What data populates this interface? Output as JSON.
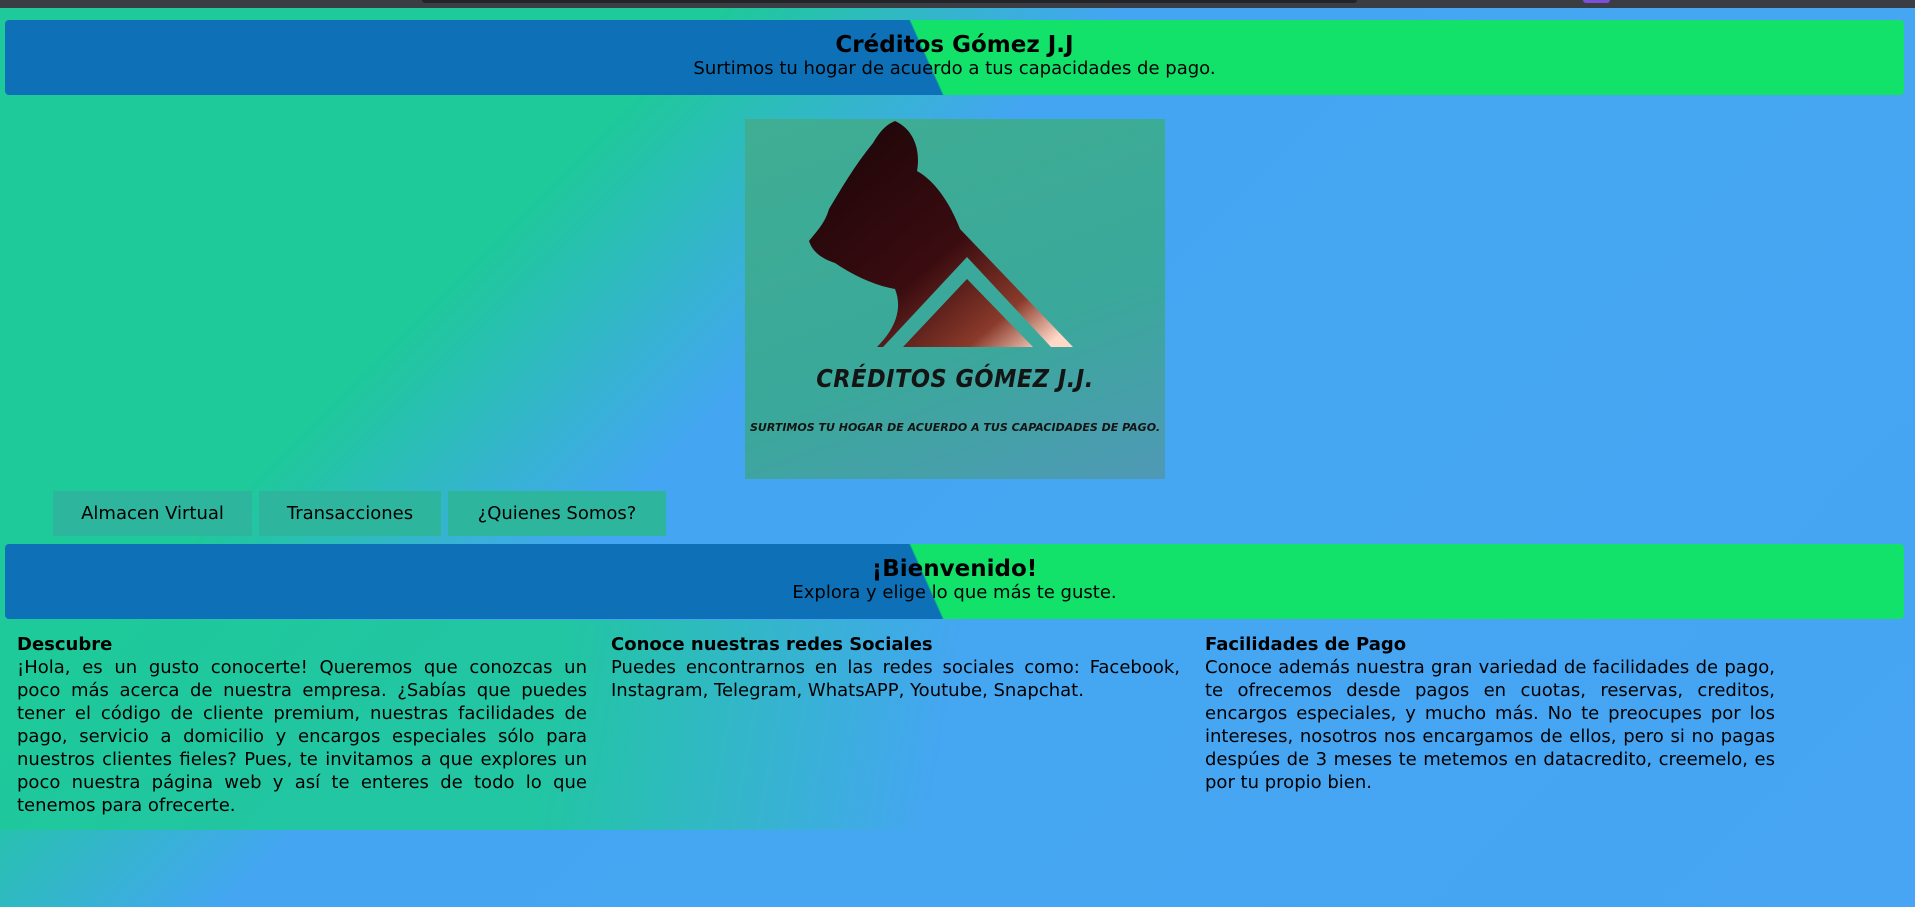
{
  "header": {
    "title": "Créditos Gómez J.J",
    "subtitle": "Surtimos tu hogar de acuerdo a tus capacidades de pago."
  },
  "logo": {
    "name": "CRÉDITOS GÓMEZ J.J.",
    "tagline": "SURTIMOS TU HOGAR DE ACUERDO A TUS CAPACIDADES DE PAGO."
  },
  "nav": {
    "items": [
      {
        "label": "Almacen Virtual"
      },
      {
        "label": "Transacciones"
      },
      {
        "label": "¿Quienes Somos?"
      }
    ]
  },
  "welcome": {
    "title": "¡Bienvenido!",
    "subtitle": "Explora y elige lo que más te guste."
  },
  "columns": [
    {
      "heading": "Descubre",
      "body": "¡Hola, es un gusto conocerte! Queremos que conozcas un poco más acerca de nuestra empresa. ¿Sabías que puedes tener el código de cliente premium, nuestras facilidades de pago, servicio a domicilio y encargos especiales sólo para nuestros clientes fieles? Pues, te invitamos a que explores un poco nuestra página web y así te enteres de todo lo que tenemos para ofrecerte."
    },
    {
      "heading": "Conoce nuestras redes Sociales",
      "body": "Puedes encontrarnos en las redes sociales como: Facebook, Instagram, Telegram, WhatsAPP, Youtube, Snapchat."
    },
    {
      "heading": "Facilidades de Pago",
      "body": "Conoce además nuestra gran variedad de facilidades de pago, te ofrecemos desde pagos en cuotas, reservas, creditos, encargos especiales, y mucho más. No te preocupes por los intereses, nosotros nos encargamos de ellos, pero si no pagas despúes de 3 meses te metemos en datacredito, creemelo, es por tu propio bien."
    }
  ],
  "colors": {
    "banner_left": "#0e71b7",
    "banner_right": "#12e26a",
    "page_green": "#1ec99a",
    "page_blue": "#47a5f3",
    "nav_bg": "#2db59e"
  }
}
